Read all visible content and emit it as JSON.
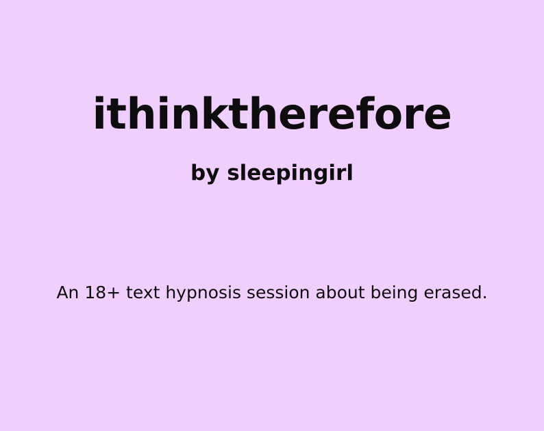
{
  "title": "ithinktherefore",
  "byline": "by sleepingirl",
  "description": "An 18+ text hypnosis session about being erased.",
  "colors": {
    "background": "#f0cffe",
    "text": "#0d0d0d"
  }
}
